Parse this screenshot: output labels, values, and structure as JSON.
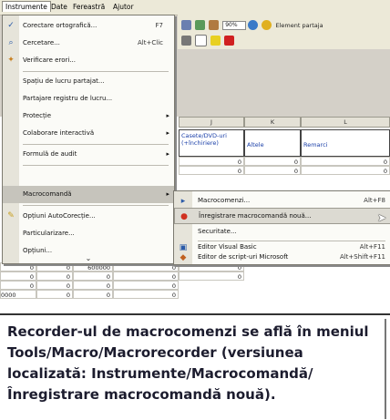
{
  "menubar": {
    "items": [
      "Instrumente",
      "Date",
      "Fereastră",
      "Ajutor"
    ]
  },
  "toolbar": {
    "zoom": "90%",
    "shared_label": "Element partaja"
  },
  "sheet": {
    "columns": [
      "J",
      "K",
      "L"
    ],
    "header_cells": [
      "Casete/DVD-uri (+închiriere)",
      "Altele",
      "Remarci"
    ],
    "row_values": [
      [
        "0",
        "0",
        "0"
      ],
      [
        "0",
        "0",
        "0"
      ],
      [
        "0",
        "0",
        "0"
      ],
      [
        "0",
        "0",
        "0"
      ]
    ],
    "left_rows": [
      [
        "0",
        "0",
        "600000"
      ],
      [
        "0",
        "0",
        "0"
      ],
      [
        "0",
        "0",
        "0"
      ],
      [
        "0000",
        "0",
        "0"
      ]
    ]
  },
  "menu": {
    "items": [
      {
        "label": "Corectare ortografică...",
        "shortcut": "F7",
        "icon": "spellcheck-icon"
      },
      {
        "label": "Cercetare...",
        "shortcut": "Alt+Clic",
        "icon": "research-icon"
      },
      {
        "label": "Verificare erori...",
        "shortcut": "",
        "icon": "error-check-icon"
      },
      {
        "label": "Spațiu de lucru partajat...",
        "shortcut": "",
        "icon": ""
      },
      {
        "label": "Partajare registru de lucru...",
        "shortcut": "",
        "icon": ""
      },
      {
        "label": "Protecție",
        "shortcut": "",
        "icon": "",
        "submenu": true
      },
      {
        "label": "Colaborare interactivă",
        "shortcut": "",
        "icon": "",
        "submenu": true
      },
      {
        "label": "Formulă de audit",
        "shortcut": "",
        "icon": "",
        "submenu": true
      },
      {
        "label": "Macrocomandă",
        "shortcut": "",
        "icon": "",
        "submenu": true
      },
      {
        "label": "Opțiuni AutoCorecție...",
        "shortcut": "",
        "icon": "autocorrect-icon"
      },
      {
        "label": "Particularizare...",
        "shortcut": "",
        "icon": ""
      },
      {
        "label": "Opțiuni...",
        "shortcut": "",
        "icon": ""
      }
    ],
    "expand_chevron": "⌄"
  },
  "submenu": {
    "items": [
      {
        "label": "Macrocomenzi...",
        "shortcut": "Alt+F8",
        "icon": "play-icon"
      },
      {
        "label": "Înregistrare macrocomandă nouă...",
        "shortcut": "",
        "icon": "record-icon"
      },
      {
        "label": "Securitate...",
        "shortcut": "",
        "icon": ""
      },
      {
        "label": "Editor Visual Basic",
        "shortcut": "Alt+F11",
        "icon": "vb-editor-icon"
      },
      {
        "label": "Editor de script-uri Microsoft",
        "shortcut": "Alt+Shift+F11",
        "icon": "script-editor-icon"
      }
    ]
  },
  "caption": {
    "text": "Recorder-ul de macrocomenzi se află în meniul Tools/Macro/Macrorecorder (versiunea localizată: Instrumente/Macrocomandă/ Înregistrare macrocomandă nouă)."
  },
  "colors": {
    "menu_bg": "#fbfbf7",
    "highlight": "#c6c4bc",
    "link_blue": "#1a3fa8",
    "caption_text": "#1c1c2e"
  }
}
